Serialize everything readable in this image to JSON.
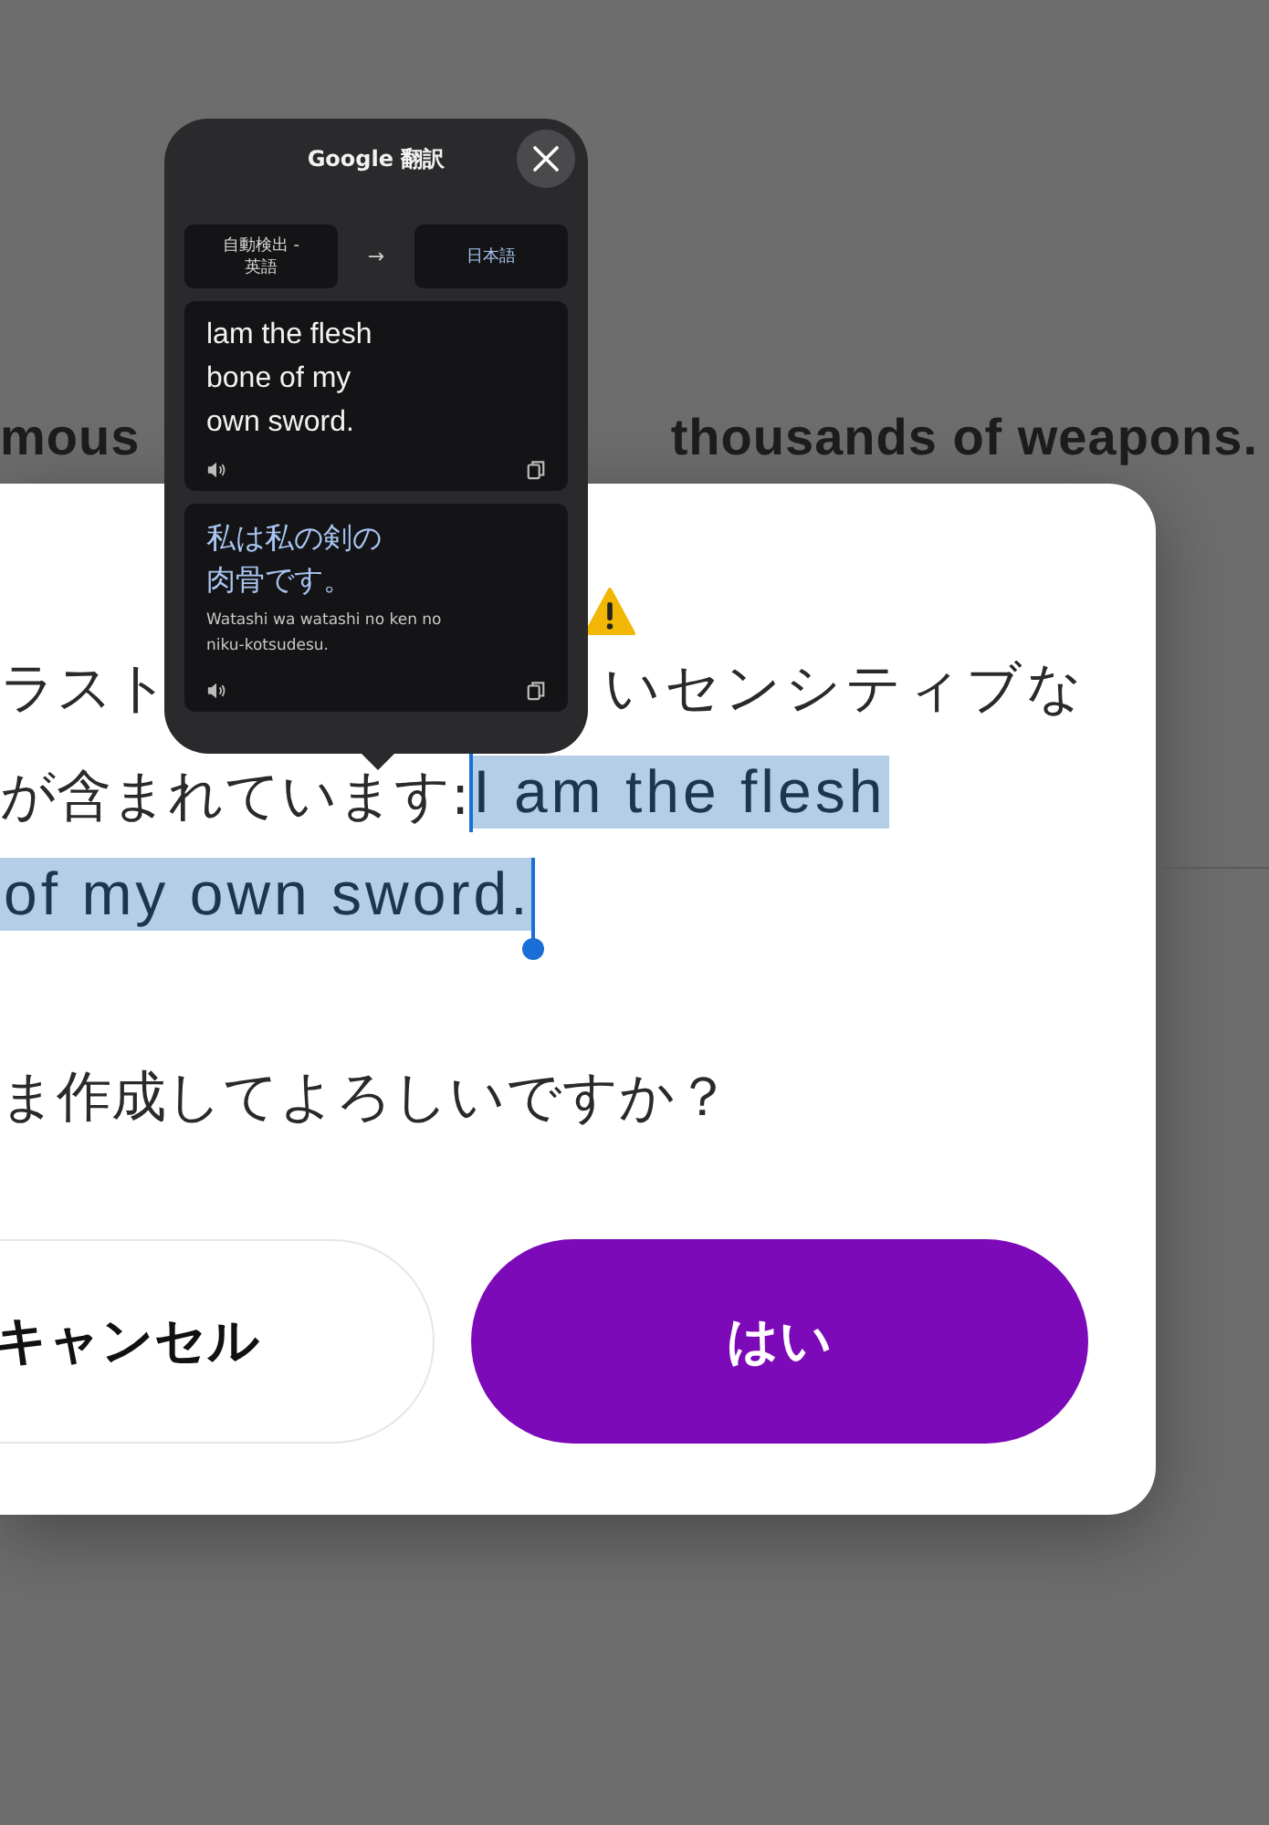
{
  "background_text": [
    "mous",
    "thousands of weapons."
  ],
  "dialog": {
    "line_1_left": "ラスト",
    "line_1_right": "いセンシティブな",
    "line_2": "が含まれています:",
    "selection": {
      "selected": true,
      "lines": [
        "I am the flesh",
        "of my own sword."
      ]
    },
    "question": "ま作成してよろしいですか？",
    "buttons": [
      {
        "label": "キャンセル",
        "kind": "secondary"
      },
      {
        "label": "はい",
        "kind": "primary"
      }
    ]
  },
  "translate_popup": {
    "title": "Google 翻訳",
    "source_language": "自動検出 -\n英語",
    "arrow": "→",
    "target_language": "日本語",
    "source_text": "lam the flesh\nbone of my\nown sword.",
    "target_text": [
      "私は私の剣の",
      "肉骨です。"
    ],
    "romanization": "Watashi wa watashi no ken no\nniku-kotsudesu."
  }
}
